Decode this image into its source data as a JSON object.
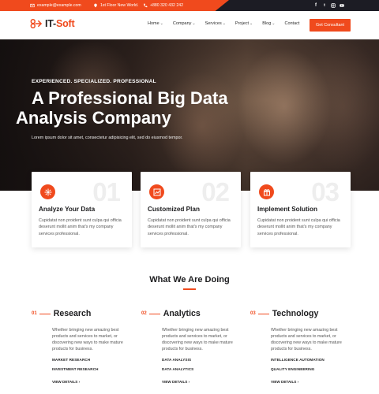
{
  "topbar": {
    "email": "example@example.com",
    "address": "1st Floor New World.",
    "phone": "+880 320 432 242",
    "social": [
      "f",
      "t",
      "in",
      "yt"
    ]
  },
  "header": {
    "logo_main": "IT-",
    "logo_accent": "Soft",
    "nav": [
      {
        "label": "Home",
        "dropdown": true
      },
      {
        "label": "Company",
        "dropdown": true
      },
      {
        "label": "Services",
        "dropdown": true
      },
      {
        "label": "Project",
        "dropdown": true
      },
      {
        "label": "Blog",
        "dropdown": true
      },
      {
        "label": "Contact",
        "dropdown": false
      }
    ],
    "cta_label": "Get Consultant"
  },
  "hero": {
    "eyebrow": "EXPERIENCED. SPECIALIZED. PROFESSIONAL",
    "title_line1": "A Professional Big Data",
    "title_line2": "Analysis Company",
    "subtitle": "Lorem ipsum dolor sit amet, consectetur adipisicing elit, sed do eiusmod tempor."
  },
  "cards": [
    {
      "number": "01",
      "title": "Analyze Your Data",
      "desc": "Cupidatat non proident sunt culpa qui officia deserunt mollit anim that's my company services professional.",
      "icon": "target-icon"
    },
    {
      "number": "02",
      "title": "Customized Plan",
      "desc": "Cupidatat non proident sunt culpa qui officia deserunt mollit anim that's my company services professional.",
      "icon": "chart-icon"
    },
    {
      "number": "03",
      "title": "Implement Solution",
      "desc": "Cupidatat non proident sunt culpa qui officia deserunt mollit anim that's my company services professional.",
      "icon": "gift-icon"
    }
  ],
  "section": {
    "title": "What We Are Doing"
  },
  "services": [
    {
      "number": "01",
      "title": "Research",
      "desc": "Whether bringing new amazing best products and services to market, or discovering new ways to make mature products for business.",
      "tags": [
        "MARKET RESEARCH",
        "INVESTMENT RESEARCH"
      ],
      "more": "VIEW DETAILS ›"
    },
    {
      "number": "02",
      "title": "Analytics",
      "desc": "Whether bringing new amazing best products and services to market, or discovering new ways to make mature products for business.",
      "tags": [
        "DATA ANALYSIS",
        "DATA ANALYTICS"
      ],
      "more": "VIEW DETAILS ›"
    },
    {
      "number": "03",
      "title": "Technology",
      "desc": "Whether bringing new amazing best products and services to market, or discovering new ways to make mature products for business.",
      "tags": [
        "INTELLIGENCE AUTOMATION",
        "QUALITY ENGINEERING"
      ],
      "more": "VIEW DETAILS ›"
    }
  ],
  "colors": {
    "accent": "#f04a1d",
    "dark": "#1c1c24"
  }
}
